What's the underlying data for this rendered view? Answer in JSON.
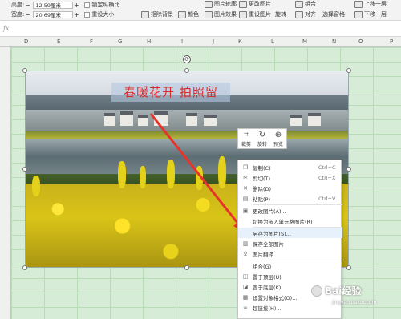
{
  "ribbon": {
    "height_label": "高度:",
    "height_value": "12.59厘米",
    "width_label": "宽度:",
    "width_value": "20.69厘米",
    "lock_ratio": "锁定纵横比",
    "reset_size": "重设大小",
    "remove_background": "抠除背景",
    "color": "颜色",
    "picture_effects": "图片效果",
    "picture_outline": "图片轮廓",
    "change_picture": "更改图片",
    "reset_picture": "重设图片",
    "rotate": "旋转",
    "align": "对齐",
    "combine": "组合",
    "selection_pane": "选择窗格",
    "bring_forward": "上移一层",
    "send_backward": "下移一层"
  },
  "formula_bar": {
    "fx": "fx",
    "value": ""
  },
  "columns": [
    "D",
    "E",
    "F",
    "G",
    "H",
    "I",
    "J",
    "K",
    "L",
    "M",
    "N",
    "O",
    "P"
  ],
  "picture": {
    "caption": "春暖花开  拍照留"
  },
  "mini_toolbar": [
    {
      "icon": "crop-icon",
      "glyph": "⌗",
      "label": "裁剪"
    },
    {
      "icon": "rotate-icon",
      "glyph": "↻",
      "label": "旋转"
    },
    {
      "icon": "preview-icon",
      "glyph": "⊕",
      "label": "预览"
    }
  ],
  "context_menu": [
    {
      "icon": "copy-icon",
      "glyph": "❐",
      "label": "复制(C)",
      "shortcut": "Ctrl+C"
    },
    {
      "icon": "cut-icon",
      "glyph": "✂",
      "label": "剪切(T)",
      "shortcut": "Ctrl+X"
    },
    {
      "icon": "delete-icon",
      "glyph": "✕",
      "label": "删除(D)",
      "shortcut": ""
    },
    {
      "icon": "paste-icon",
      "glyph": "▤",
      "label": "粘贴(P)",
      "shortcut": "Ctrl+V"
    },
    {
      "icon": "change-picture-icon",
      "glyph": "▣",
      "label": "更改图片(A)...",
      "shortcut": ""
    },
    {
      "icon": "",
      "glyph": "",
      "label": "切换为嵌入单元格图片(R)",
      "shortcut": ""
    },
    {
      "icon": "",
      "glyph": "",
      "label": "另存为图片(S)...",
      "shortcut": ""
    },
    {
      "icon": "save-all-icon",
      "glyph": "▥",
      "label": "保存全部图片",
      "shortcut": ""
    },
    {
      "icon": "translate-icon",
      "glyph": "文",
      "label": "图片翻译",
      "shortcut": ""
    },
    {
      "icon": "",
      "glyph": "",
      "label": "组合(G)",
      "shortcut": ""
    },
    {
      "icon": "bring-top-icon",
      "glyph": "◫",
      "label": "置于顶层(U)",
      "shortcut": ""
    },
    {
      "icon": "send-bottom-icon",
      "glyph": "◪",
      "label": "置于底层(K)",
      "shortcut": ""
    },
    {
      "icon": "format-icon",
      "glyph": "▦",
      "label": "设置对象格式(O)...",
      "shortcut": ""
    },
    {
      "icon": "hyperlink-icon",
      "glyph": "∞",
      "label": "超链接(H)...",
      "shortcut": ""
    }
  ],
  "watermark": {
    "text": "Bai经验",
    "sub": "jingyan.baidu.com"
  },
  "colors": {
    "caption": "#d82a2a",
    "arrow": "#e8322c",
    "sheet": "#d6ecd6"
  }
}
